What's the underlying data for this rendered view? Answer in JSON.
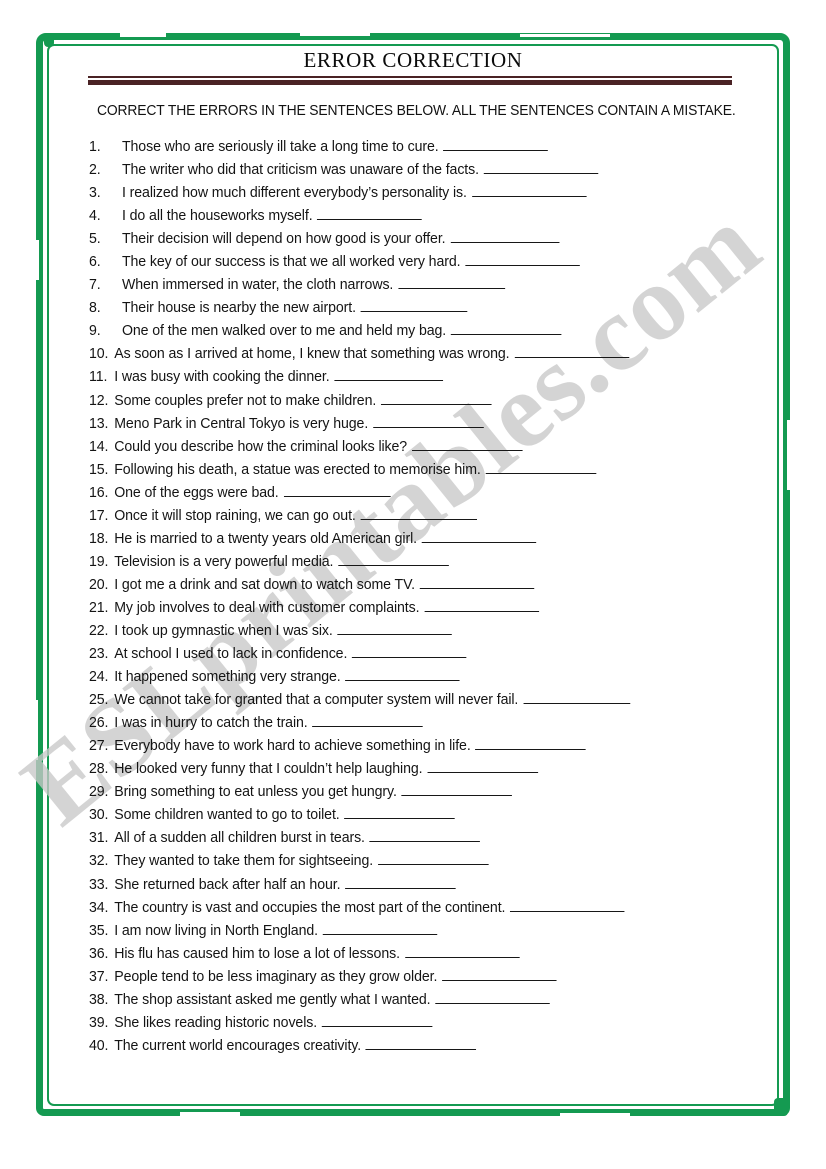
{
  "document": {
    "title": "ERROR CORRECTION",
    "instruction": "CORRECT THE ERRORS IN THE SENTENCES BELOW. ALL THE SENTENCES CONTAIN A MISTAKE.",
    "watermark": "ESLprintables.com",
    "frame_color": "#149a51",
    "rule_color": "#4a2224",
    "blank": "_______________"
  },
  "items": [
    {
      "number": "1.",
      "text": "Those who are seriously ill take a long time to cure.",
      "blank_width": 108
    },
    {
      "number": "2.",
      "text": "The writer who did that criticism was unaware of the facts.",
      "blank_width": 118
    },
    {
      "number": "3.",
      "text": "I realized how much different everybody’s personality is.",
      "blank_width": 118
    },
    {
      "number": "4.",
      "text": "I do all the houseworks myself.",
      "blank_width": 108
    },
    {
      "number": "5.",
      "text": "Their decision will depend on how good is your offer.",
      "blank_width": 112
    },
    {
      "number": "6.",
      "text": "The key of our success is that we all worked very hard.",
      "blank_width": 118
    },
    {
      "number": "7.",
      "text": "When immersed in water, the cloth narrows.",
      "blank_width": 110
    },
    {
      "number": "8.",
      "text": "Their house is nearby the new airport.",
      "blank_width": 110
    },
    {
      "number": "9.",
      "text": "One of the men walked over to me and held my bag.",
      "blank_width": 114
    },
    {
      "number": "10.",
      "text": "As soon as I arrived at home, I knew that something was wrong.",
      "blank_width": 118
    },
    {
      "number": "11.",
      "text": "I was busy with cooking the dinner.",
      "blank_width": 112
    },
    {
      "number": "12.",
      "text": "Some couples prefer not to make children.",
      "blank_width": 114
    },
    {
      "number": "13.",
      "text": "Meno Park in Central Tokyo is very huge.",
      "blank_width": 114
    },
    {
      "number": "14.",
      "text": "Could you describe how the criminal looks like?",
      "blank_width": 114
    },
    {
      "number": "15.",
      "text": "Following his death, a statue was erected to memorise him.",
      "blank_width": 114
    },
    {
      "number": "16.",
      "text": "One of the eggs were bad.",
      "blank_width": 110
    },
    {
      "number": "17.",
      "text": "Once it will stop raining, we can go out.",
      "blank_width": 120
    },
    {
      "number": "18.",
      "text": "He is married to a twenty years old American girl.",
      "blank_width": 118
    },
    {
      "number": "19.",
      "text": "Television is a very powerful media.",
      "blank_width": 114
    },
    {
      "number": "20.",
      "text": "I got me a drink and sat down to watch some TV.",
      "blank_width": 118
    },
    {
      "number": "21.",
      "text": "My job involves to deal with customer complaints.",
      "blank_width": 118
    },
    {
      "number": "22.",
      "text": "I took up gymnastic when I was six.",
      "blank_width": 118
    },
    {
      "number": "23.",
      "text": "At school I used to lack in confidence.",
      "blank_width": 118
    },
    {
      "number": "24.",
      "text": "It happened something very strange.",
      "blank_width": 118
    },
    {
      "number": "25.",
      "text": "We cannot take for granted that a computer system will never fail.",
      "blank_width": 110
    },
    {
      "number": "26.",
      "text": "I was in hurry to catch the train.",
      "blank_width": 114
    },
    {
      "number": "27.",
      "text": "Everybody have to work hard to achieve something in life.",
      "blank_width": 114
    },
    {
      "number": "28.",
      "text": "He looked very funny that I couldn’t help laughing.",
      "blank_width": 114
    },
    {
      "number": "29.",
      "text": "Bring something to eat unless you get hungry.",
      "blank_width": 114
    },
    {
      "number": "30.",
      "text": "Some children wanted to go to toilet.",
      "blank_width": 114
    },
    {
      "number": "31.",
      "text": "All of a sudden all children burst in tears.",
      "blank_width": 114
    },
    {
      "number": "32.",
      "text": "They wanted to take them for sightseeing.",
      "blank_width": 114
    },
    {
      "number": "33.",
      "text": "She returned back after half an hour.",
      "blank_width": 114
    },
    {
      "number": "34.",
      "text": "The country is vast and occupies the most part of the continent.",
      "blank_width": 118
    },
    {
      "number": "35.",
      "text": "I am now living in North England.",
      "blank_width": 118
    },
    {
      "number": "36.",
      "text": "His flu has caused him to lose a lot of lessons.",
      "blank_width": 118
    },
    {
      "number": "37.",
      "text": "People tend to be less imaginary as they grow older.",
      "blank_width": 118
    },
    {
      "number": "38.",
      "text": "The shop assistant asked me gently what I wanted.",
      "blank_width": 118
    },
    {
      "number": "39.",
      "text": "She likes reading historic novels.",
      "blank_width": 114
    },
    {
      "number": "40.",
      "text": "The current world encourages creativity.",
      "blank_width": 114
    }
  ]
}
